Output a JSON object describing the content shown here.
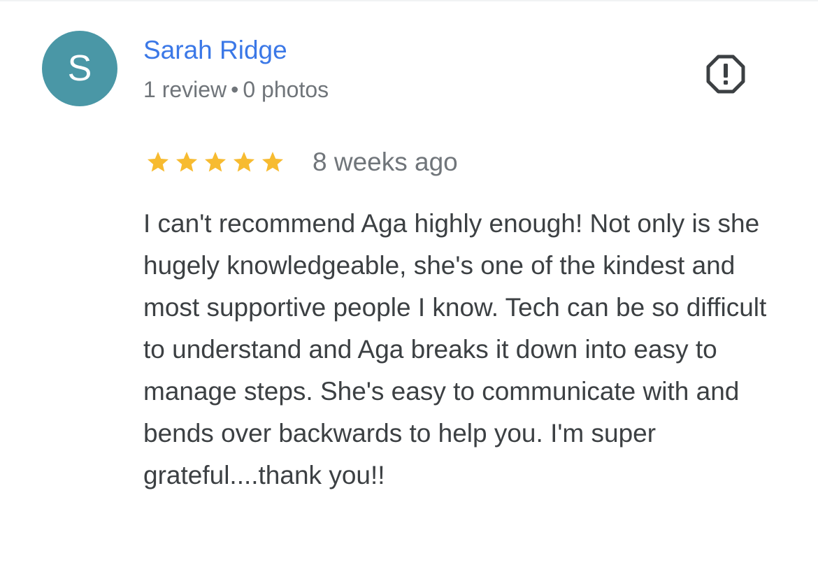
{
  "review": {
    "author": {
      "initial": "S",
      "name": "Sarah Ridge",
      "reviews_count": "1 review",
      "separator": "•",
      "photos_count": "0 photos",
      "avatar_color": "#4a97a6"
    },
    "report_icon": "report-flag-icon",
    "rating": {
      "stars": 5,
      "max_stars": 5,
      "star_color": "#f7bb30",
      "star_icon": "star-icon"
    },
    "date": "8 weeks ago",
    "text": "I can't recommend Aga highly enough! Not only is she hugely knowledgeable, she's one of the kindest and most supportive people I know. Tech can be so difficult to understand and Aga breaks it down into easy to manage steps. She's easy to communicate with and bends over backwards to help you. I'm super grateful....thank you!!"
  },
  "colors": {
    "name_link": "#3b78e7",
    "meta_text": "#70757a",
    "body_text": "#3c4043",
    "icon_dark": "#3c4043"
  }
}
